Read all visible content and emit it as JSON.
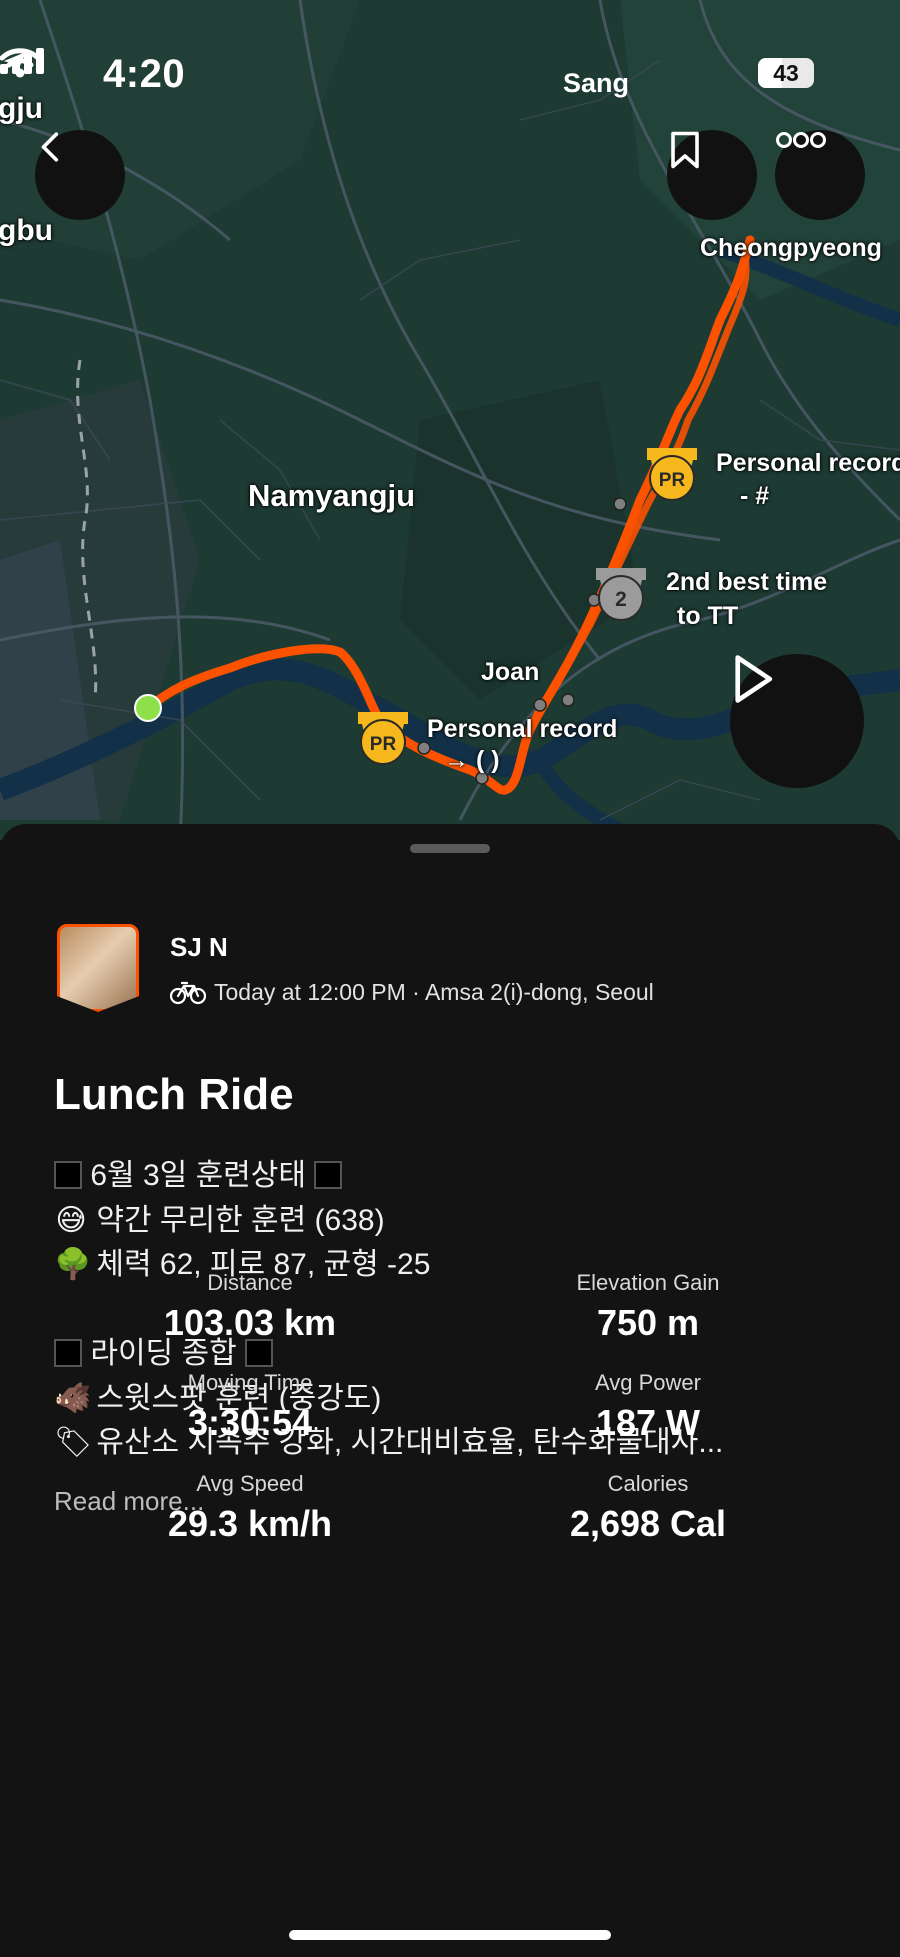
{
  "status_bar": {
    "time": "4:20",
    "carrier": "Sang",
    "battery": "43"
  },
  "map": {
    "labels": {
      "partial_top_left": "gju",
      "partial_left": "gbu",
      "city_1": "Namyangju",
      "city_2": "Cheongpyeong",
      "place": "Joan"
    },
    "achievements": [
      {
        "badge": "PR",
        "line1": "Personal record",
        "line2": "- #"
      },
      {
        "badge": "2",
        "line1": "2nd best time",
        "line2": "to TT"
      },
      {
        "badge": "PR",
        "line1": "Personal record",
        "line2": "→ ( )"
      }
    ],
    "route_color": "#fc5200",
    "start_color": "#8ee04b"
  },
  "activity": {
    "athlete_name": "SJ N",
    "meta": "Today at 12:00 PM · Amsa 2(i)-dong, Seoul",
    "title": "Lunch Ride",
    "description": [
      {
        "prefix": "box",
        "text": "6월 3일 훈련상태",
        "suffix": "box"
      },
      {
        "prefix": "😅",
        "text": "약간 무리한 훈련 (638)",
        "suffix": ""
      },
      {
        "prefix": "🌳",
        "text": "체력 62, 피로 87, 균형 -25",
        "suffix": ""
      },
      {
        "prefix": "",
        "text": "",
        "suffix": ""
      },
      {
        "prefix": "box",
        "text": "라이딩 종합",
        "suffix": "box"
      },
      {
        "prefix": "🐗",
        "text": "스윗스팟 훈련 (중강도)",
        "suffix": ""
      },
      {
        "prefix": "🏷",
        "text": "유산소 지속주 강화, 시간대비효율, 탄수화물대사...",
        "suffix": ""
      }
    ],
    "read_more": "Read more..."
  },
  "stats": [
    {
      "label": "Distance",
      "value": "103.03 km"
    },
    {
      "label": "Elevation Gain",
      "value": "750 m"
    },
    {
      "label": "Moving Time",
      "value": "3:30:54"
    },
    {
      "label": "Avg Power",
      "value": "187 W"
    },
    {
      "label": "Avg Speed",
      "value": "29.3 km/h"
    },
    {
      "label": "Calories",
      "value": "2,698 Cal"
    }
  ]
}
